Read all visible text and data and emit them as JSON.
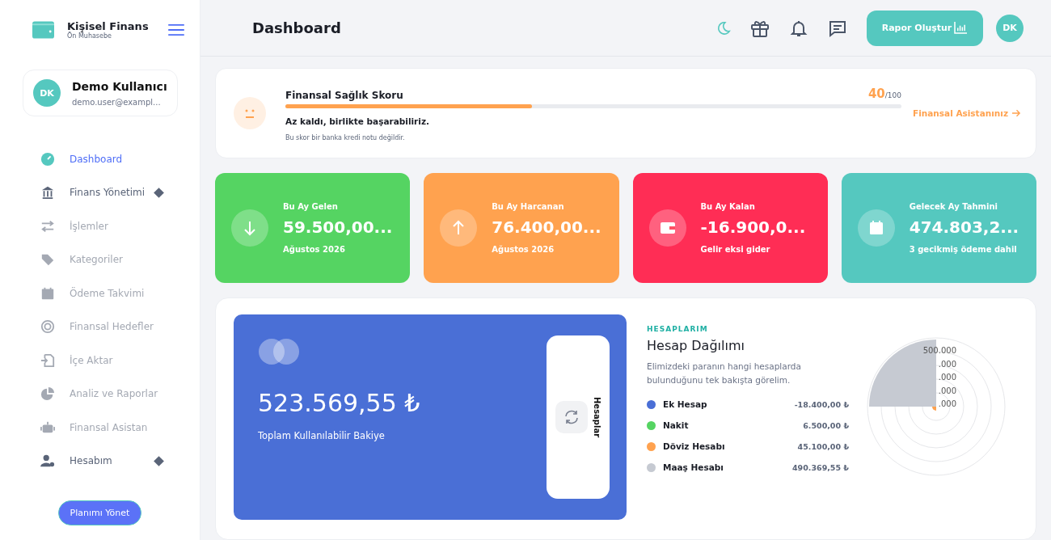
{
  "brand": {
    "title": "Kişisel Finans",
    "subtitle": "Ön Muhasebe"
  },
  "user": {
    "initials": "DK",
    "name": "Demo Kullanıcı",
    "email": "demo.user@exampl..."
  },
  "sidebar": {
    "items": [
      {
        "label": "Dashboard",
        "selected": true,
        "has_submenu": false
      },
      {
        "label": "Finans Yönetimi",
        "selected": false,
        "has_submenu": true
      },
      {
        "label": "İşlemler",
        "selected": false,
        "has_submenu": false
      },
      {
        "label": "Kategoriler",
        "selected": false,
        "has_submenu": false
      },
      {
        "label": "Ödeme Takvimi",
        "selected": false,
        "has_submenu": false
      },
      {
        "label": "Finansal Hedefler",
        "selected": false,
        "has_submenu": false
      },
      {
        "label": "İçe Aktar",
        "selected": false,
        "has_submenu": false
      },
      {
        "label": "Analiz ve Raporlar",
        "selected": false,
        "has_submenu": false
      },
      {
        "label": "Finansal Asistan",
        "selected": false,
        "has_submenu": false
      },
      {
        "label": "Hesabım",
        "selected": false,
        "has_submenu": true
      }
    ],
    "plan_button": "Planımı Yönet"
  },
  "header": {
    "title": "Dashboard",
    "report_button": "Rapor Oluştur",
    "avatar": "DK"
  },
  "health": {
    "title": "Finansal Sağlık Skoru",
    "score": "40",
    "max": "/100",
    "level": 0.4,
    "message": "Az kaldı, birlikte başarabiliriz.",
    "note": "Bu skor bir banka kredi notu değildir.",
    "link": "Finansal Asistanınız"
  },
  "stats": [
    {
      "label": "Bu Ay Gelen",
      "value": "59.500,00...",
      "sub": "Ağustos 2026",
      "color": "#55d462"
    },
    {
      "label": "Bu Ay Harcanan",
      "value": "76.400,00...",
      "sub": "Ağustos 2026",
      "color": "#ffa24f"
    },
    {
      "label": "Bu Ay Kalan",
      "value": "-16.900,0...",
      "sub": "Gelir eksi gider",
      "color": "#ff2d55"
    },
    {
      "label": "Gelecek Ay Tahmini",
      "value": "474.803,2...",
      "sub": "3 gecikmiş ödeme dahil",
      "color": "#55c8bf"
    }
  ],
  "balance_card": {
    "amount": "523.569,55 ₺",
    "label": "Toplam Kullanılabilir Bakiye",
    "side_tab": "Hesaplar"
  },
  "accounts": {
    "eyebrow": "HESAPLARIM",
    "title": "Hesap Dağılımı",
    "description": "Elimizdeki paranın hangi hesaplarda bulunduğunu tek bakışta görelim.",
    "items": [
      {
        "name": "Ek Hesap",
        "amount": "-18.400,00 ₺",
        "color": "#4a6fd6"
      },
      {
        "name": "Nakit",
        "amount": "6.500,00 ₺",
        "color": "#55d462"
      },
      {
        "name": "Döviz Hesabı",
        "amount": "45.100,00 ₺",
        "color": "#ffa24f"
      },
      {
        "name": "Maaş Hesabı",
        "amount": "490.369,55 ₺",
        "color": "#c6cad2"
      }
    ],
    "chart_ticks": [
      "500.000",
      ".000",
      ".000",
      ".000",
      ".000"
    ]
  }
}
